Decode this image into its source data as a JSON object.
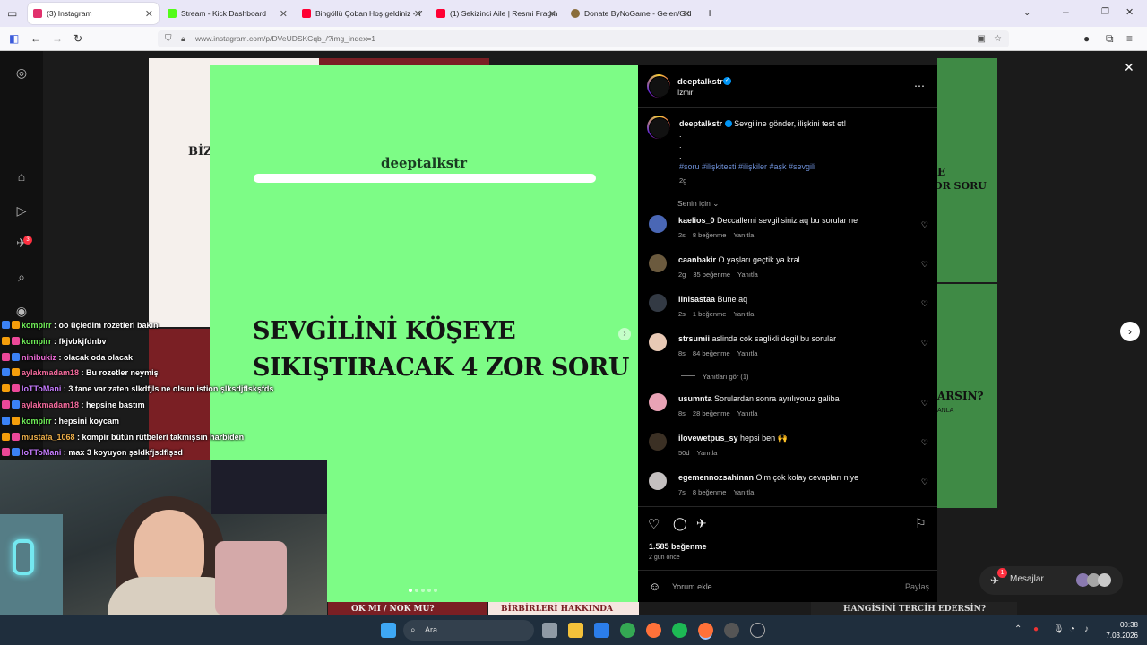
{
  "browser": {
    "tabs": [
      {
        "label": "(3) Instagram",
        "color": "#e1306c",
        "active": true
      },
      {
        "label": "Stream - Kick Dashboard",
        "color": "#53fc18"
      },
      {
        "label": "Bingöllü Çoban Hoş geldiniz - Y",
        "color": "#ff0033"
      },
      {
        "label": "(1) Sekizinci Aile | Resmi Fragm",
        "color": "#ff0033"
      },
      {
        "label": "Donate ByNoGame - Gelen/Gid",
        "color": "#8a6d3b"
      }
    ],
    "url": "www.instagram.com/p/DVeUDSKCqb_/?img_index=1"
  },
  "post": {
    "brand": "deeptalkstr",
    "headline_line1": "SEVGİLİNİ KÖŞEYE",
    "headline_line2": "SIKIŞTIRACAK 4 ZOR SORU",
    "image_bg": "#7dfc86"
  },
  "side": {
    "username": "deeptalkstr",
    "location": "İzmir",
    "caption_user": "deeptalkstr",
    "caption_text": "Sevgiline gönder, ilişkini test et!",
    "dot": ".",
    "hashtags": "#soru #ilişkitesti #ilişkiler #aşk #sevgili",
    "caption_time": "2g",
    "sort": "Senin için",
    "likes": "1.585 beğenme",
    "post_age": "2 gün önce",
    "add_comment": "Yorum ekle...",
    "share": "Paylaş",
    "view_replies": "Yanıtları gör (1)",
    "reply_label": "Yanıtla"
  },
  "comments": [
    {
      "user": "kaelios_0",
      "text": "Deccallemi sevgilisiniz aq bu sorular ne",
      "time": "2s",
      "likes": "8 beğenme",
      "color": "#4a67b5"
    },
    {
      "user": "caanbakir",
      "text": "O yaşları geçtik ya kral",
      "time": "2g",
      "likes": "35 beğenme",
      "color": "#6b5a3e"
    },
    {
      "user": "llnisastaa",
      "text": "Bune aq",
      "time": "2s",
      "likes": "1 beğenme",
      "color": "#333a44"
    },
    {
      "user": "strsumii",
      "text": "aslinda cok saglikli degil bu sorular",
      "time": "8s",
      "likes": "84 beğenme",
      "color": "#e8c9b5"
    },
    {
      "user": "usumnta",
      "text": "Sorulardan sonra ayrılıyoruz galiba",
      "time": "8s",
      "likes": "28 beğenme",
      "color": "#e8a2b5"
    },
    {
      "user": "ilovewetpus_sy",
      "text": "hepsi ben 🙌",
      "time": "50d",
      "likes": "",
      "color": "#3b3024"
    },
    {
      "user": "egemennozsahinnn",
      "text": "Olm çok kolay cevapları niye",
      "time": "7s",
      "likes": "8 beğenme",
      "color": "#c4c0c0"
    }
  ],
  "chat": [
    {
      "user": "kompirr",
      "msg": "oo üçledim rozetleri bakın",
      "color": "#72f25a"
    },
    {
      "user": "kompirr",
      "msg": "fkjvbkjfdnbv",
      "color": "#72f25a"
    },
    {
      "user": "ninibukiz",
      "msg": "olacak oda olacak",
      "color": "#f06bd8"
    },
    {
      "user": "aylakmadam18",
      "msg": "Bu rozetler neymiş",
      "color": "#f66b9e"
    },
    {
      "user": "loTToMani",
      "msg": "3 tane var zaten slkdfjls ne olsun istion şlksdjflskşfds",
      "color": "#c67bff"
    },
    {
      "user": "aylakmadam18",
      "msg": "hepsine bastım",
      "color": "#f66b9e"
    },
    {
      "user": "kompirr",
      "msg": "hepsini koycam",
      "color": "#72f25a"
    },
    {
      "user": "mustafa_1068",
      "msg": "kompir bütün rütbeleri takmışsın harbiden",
      "color": "#f0b04a"
    },
    {
      "user": "loTToMani",
      "msg": "max 3 koyuyon şsldkfjsdflşsd",
      "color": "#c67bff"
    }
  ],
  "background": {
    "tile1": "BİZ",
    "tile2": "E",
    "tile3": "OR SORU",
    "tile4": "ARSIN?",
    "tile5": "ANLA",
    "tile6": "OK MI / NOK MU?",
    "tile7": "BİRBİRLERİ HAKKINDA",
    "tile8": "HANGİSİNİ TERCİH EDERSİN?",
    "messages": "Mesajlar",
    "msg_badge": "1",
    "notif_badge": "3"
  },
  "taskbar": {
    "search": "Ara",
    "time": "00:38",
    "date": "7.03.2026"
  }
}
